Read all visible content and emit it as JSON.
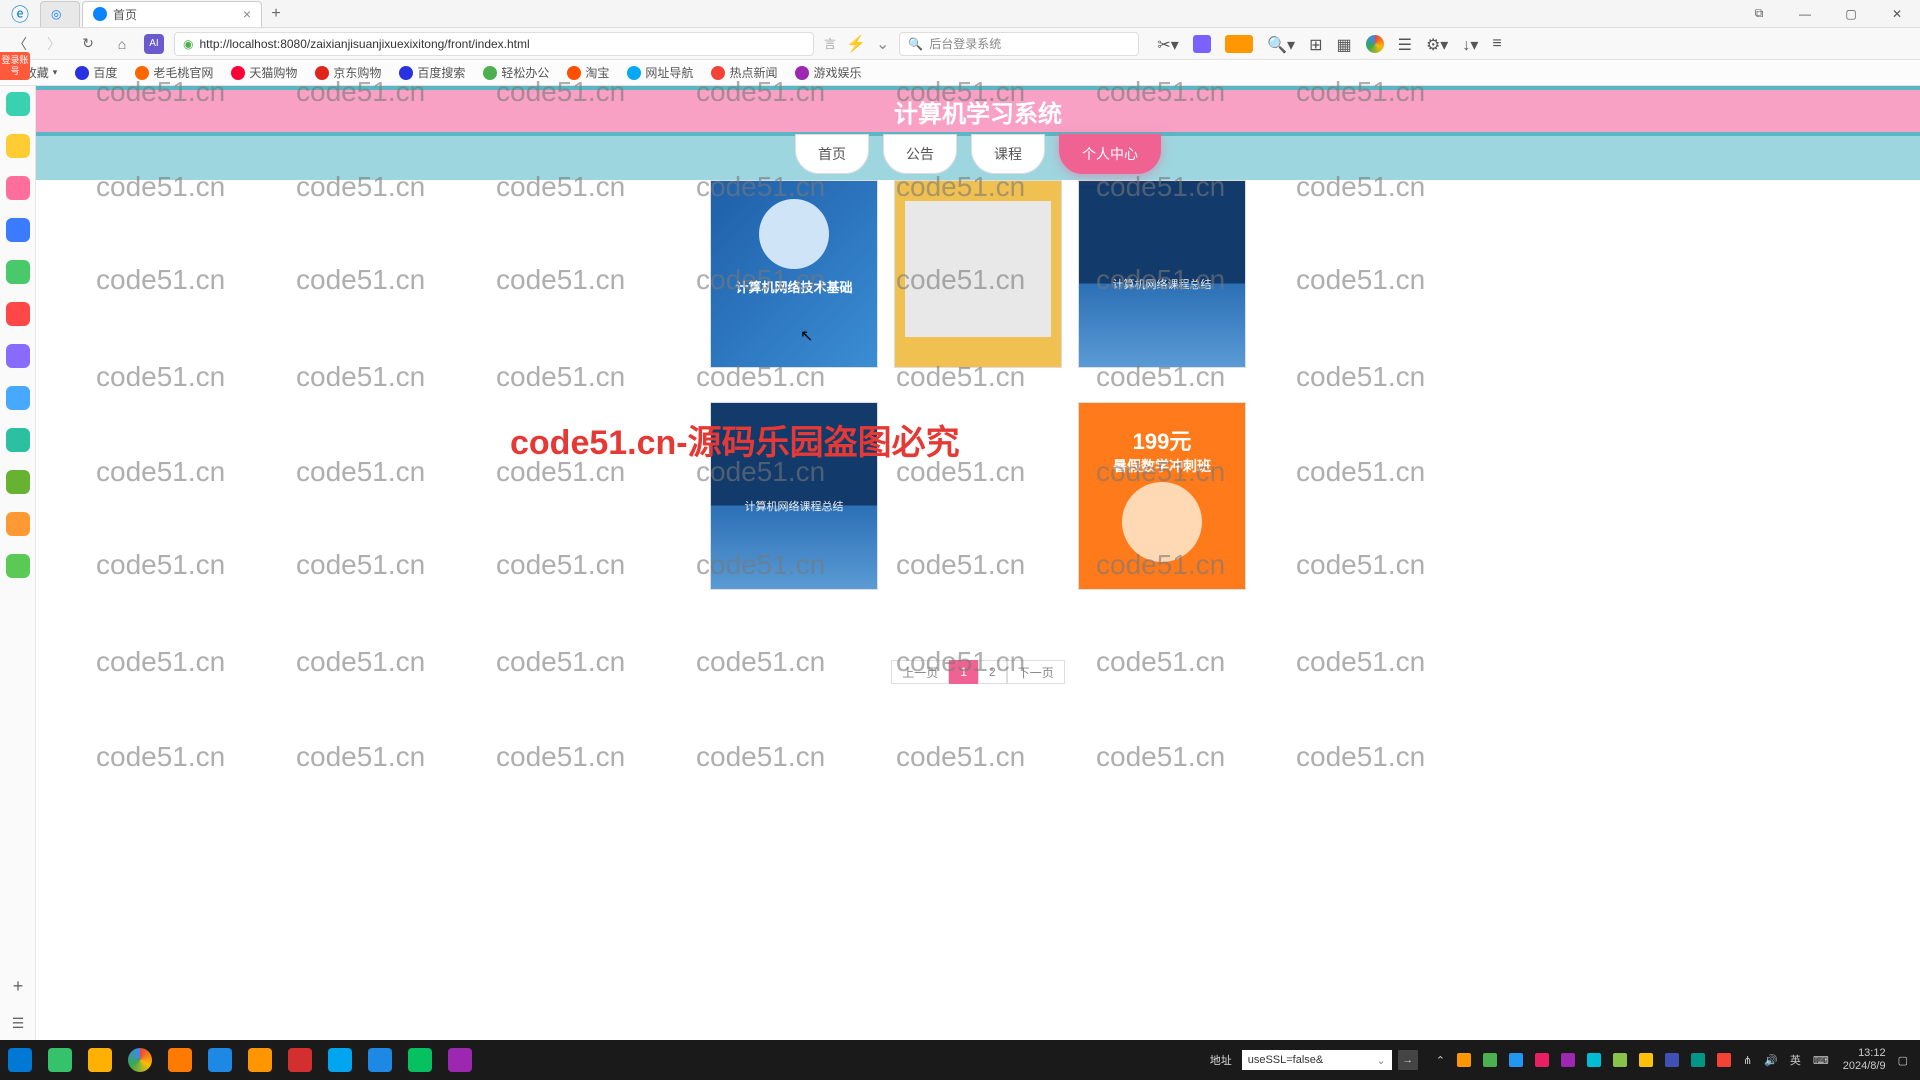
{
  "browser": {
    "tab_inactive_icon": "◉",
    "tabs": [
      {
        "title": "首页",
        "active": true
      }
    ],
    "url": "http://localhost:8080/zaixianjisuanjixuexixitong/front/index.html",
    "search_placeholder": "后台登录系统",
    "window_controls": {
      "pip": "⧉",
      "min": "—",
      "max": "▢",
      "close": "✕"
    }
  },
  "bookmarks": {
    "fav_label": "收藏",
    "items": [
      "百度",
      "老毛桃官网",
      "天猫购物",
      "京东购物",
      "百度搜索",
      "轻松办公",
      "淘宝",
      "网址导航",
      "热点新闻",
      "游戏娱乐"
    ]
  },
  "left_tag": "登录账号",
  "page": {
    "title": "计算机学习系统",
    "nav": [
      "首页",
      "公告",
      "课程",
      "个人中心"
    ],
    "nav_active_index": 3,
    "cards_row1": [
      {
        "kind": "book",
        "text1": "计算机网络技术基础"
      },
      {
        "kind": "class"
      },
      {
        "kind": "net",
        "text1": "计算机网络课程总结"
      }
    ],
    "cards_row2": [
      {
        "kind": "net",
        "text1": "计算机网络课程总结"
      },
      {
        "kind": "blank"
      },
      {
        "kind": "orange",
        "price": "199元",
        "sub": "暑假数学冲刺班"
      }
    ],
    "pagination": {
      "prev": "上一页",
      "pages": [
        "1",
        "2"
      ],
      "active": "1",
      "next": "下一页"
    }
  },
  "watermark": {
    "text": "code51.cn",
    "big": "code51.cn-源码乐园盗图必究"
  },
  "taskbar": {
    "addr_label": "地址",
    "addr_value": "useSSL=false&",
    "ime": "英",
    "time": "13:12",
    "date": "2024/8/9"
  },
  "sidebar_colors": [
    "#3ad1b0",
    "#ffcc33",
    "#ff6e9c",
    "#3a7bff",
    "#4ac96b",
    "#ff4747",
    "#8a6bff",
    "#46a8ff",
    "#2bc0a0",
    "#67b231",
    "#ff9933",
    "#5ac955"
  ],
  "task_colors": [
    "#0078d4",
    "#36c26b",
    "#ffb000",
    "#ea4335",
    "#ff7a00",
    "#4285f4",
    "#ff9500",
    "#d32f2f",
    "#00a4ef",
    "#1e88e5",
    "#07c160",
    "#9c27b0"
  ],
  "addr_icons": [
    "#ff6b00",
    "#4caf50"
  ],
  "toolbar_colors": [
    "#ff9500",
    "#7b61ff",
    "#ff9800",
    "#607d8b",
    "#9e9e9e",
    "#4caf50",
    "#03a9f4",
    "#ff5722",
    "#9c27b0",
    "#607d8b",
    "#795548"
  ],
  "tray_colors": [
    "#ff9800",
    "#4caf50",
    "#2196f3",
    "#e91e63",
    "#9c27b0",
    "#00bcd4",
    "#8bc34a",
    "#ffc107",
    "#3f51b5",
    "#009688",
    "#f44336",
    "#607d8b",
    "#795548"
  ]
}
